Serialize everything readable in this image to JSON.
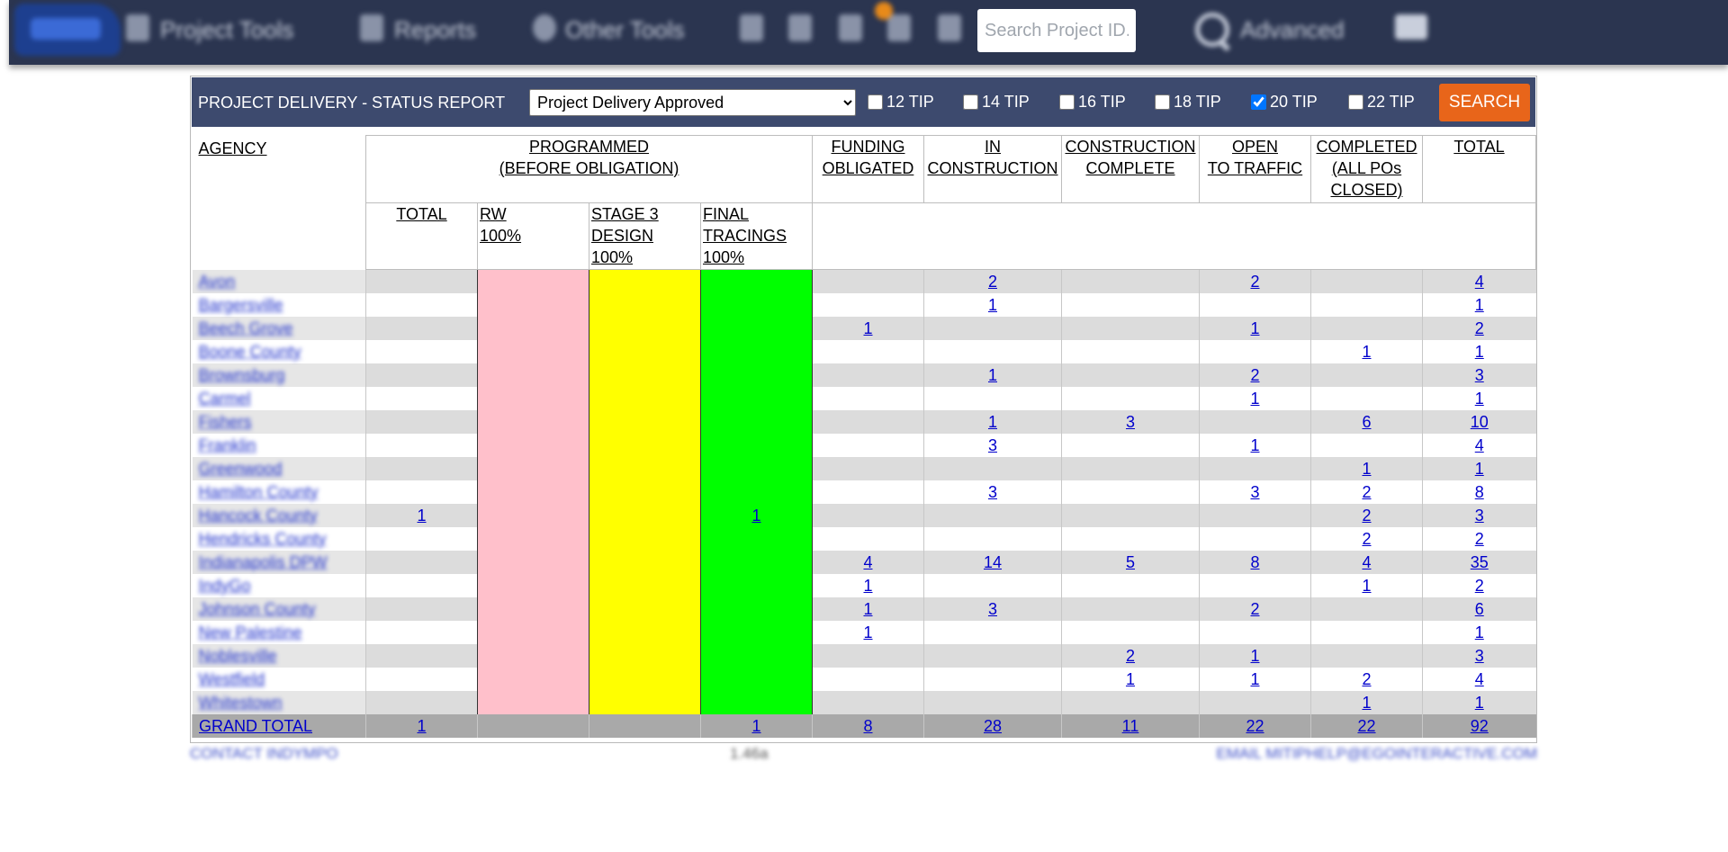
{
  "nav": {
    "items": [
      "Project Tools",
      "Reports",
      "Other Tools"
    ],
    "search_placeholder": "Search Project ID...",
    "advanced_label": "Advanced"
  },
  "filter": {
    "title": "PROJECT DELIVERY - STATUS REPORT",
    "selected_status": "Project Delivery Approved",
    "tips": [
      {
        "label": "12 TIP",
        "checked": false
      },
      {
        "label": "14 TIP",
        "checked": false
      },
      {
        "label": "16 TIP",
        "checked": false
      },
      {
        "label": "18 TIP",
        "checked": false
      },
      {
        "label": "20 TIP",
        "checked": true
      },
      {
        "label": "22 TIP",
        "checked": false
      }
    ],
    "search_label": "SEARCH"
  },
  "table": {
    "agency_header": "AGENCY",
    "programmed_header": [
      "PROGRAMMED",
      "(BEFORE OBLIGATION)"
    ],
    "funding_header": [
      "FUNDING",
      "OBLIGATED"
    ],
    "in_construction_header": [
      "IN",
      "CONSTRUCTION"
    ],
    "construction_complete_header": [
      "CONSTRUCTION",
      "COMPLETE"
    ],
    "open_header": [
      "OPEN",
      "TO TRAFFIC"
    ],
    "completed_header": [
      "COMPLETED",
      "(ALL POs",
      "CLOSED)"
    ],
    "total_header": "TOTAL",
    "sub_total_header": "TOTAL",
    "rw_header": [
      "RW",
      "100%"
    ],
    "stage3_header": [
      "STAGE 3",
      "DESIGN",
      "100%"
    ],
    "final_header": [
      "FINAL",
      "TRACINGS",
      "100%"
    ],
    "rows": [
      {
        "agency": "Avon",
        "prog_total": "",
        "rw": "",
        "stage3": "",
        "final": "",
        "funding": "",
        "in_constr": "2",
        "constr_complete": "",
        "open": "2",
        "completed": "",
        "total": "4"
      },
      {
        "agency": "Bargersville",
        "prog_total": "",
        "rw": "",
        "stage3": "",
        "final": "",
        "funding": "",
        "in_constr": "1",
        "constr_complete": "",
        "open": "",
        "completed": "",
        "total": "1"
      },
      {
        "agency": "Beech Grove",
        "prog_total": "",
        "rw": "",
        "stage3": "",
        "final": "",
        "funding": "1",
        "in_constr": "",
        "constr_complete": "",
        "open": "1",
        "completed": "",
        "total": "2"
      },
      {
        "agency": "Boone County",
        "prog_total": "",
        "rw": "",
        "stage3": "",
        "final": "",
        "funding": "",
        "in_constr": "",
        "constr_complete": "",
        "open": "",
        "completed": "1",
        "total": "1"
      },
      {
        "agency": "Brownsburg",
        "prog_total": "",
        "rw": "",
        "stage3": "",
        "final": "",
        "funding": "",
        "in_constr": "1",
        "constr_complete": "",
        "open": "2",
        "completed": "",
        "total": "3"
      },
      {
        "agency": "Carmel",
        "prog_total": "",
        "rw": "",
        "stage3": "",
        "final": "",
        "funding": "",
        "in_constr": "",
        "constr_complete": "",
        "open": "1",
        "completed": "",
        "total": "1"
      },
      {
        "agency": "Fishers",
        "prog_total": "",
        "rw": "",
        "stage3": "",
        "final": "",
        "funding": "",
        "in_constr": "1",
        "constr_complete": "3",
        "open": "",
        "completed": "6",
        "total": "10"
      },
      {
        "agency": "Franklin",
        "prog_total": "",
        "rw": "",
        "stage3": "",
        "final": "",
        "funding": "",
        "in_constr": "3",
        "constr_complete": "",
        "open": "1",
        "completed": "",
        "total": "4"
      },
      {
        "agency": "Greenwood",
        "prog_total": "",
        "rw": "",
        "stage3": "",
        "final": "",
        "funding": "",
        "in_constr": "",
        "constr_complete": "",
        "open": "",
        "completed": "1",
        "total": "1"
      },
      {
        "agency": "Hamilton County",
        "prog_total": "",
        "rw": "",
        "stage3": "",
        "final": "",
        "funding": "",
        "in_constr": "3",
        "constr_complete": "",
        "open": "3",
        "completed": "2",
        "total": "8"
      },
      {
        "agency": "Hancock County",
        "prog_total": "1",
        "rw": "",
        "stage3": "",
        "final": "1",
        "funding": "",
        "in_constr": "",
        "constr_complete": "",
        "open": "",
        "completed": "2",
        "total": "3"
      },
      {
        "agency": "Hendricks County",
        "prog_total": "",
        "rw": "",
        "stage3": "",
        "final": "",
        "funding": "",
        "in_constr": "",
        "constr_complete": "",
        "open": "",
        "completed": "2",
        "total": "2"
      },
      {
        "agency": "Indianapolis DPW",
        "prog_total": "",
        "rw": "",
        "stage3": "",
        "final": "",
        "funding": "4",
        "in_constr": "14",
        "constr_complete": "5",
        "open": "8",
        "completed": "4",
        "total": "35"
      },
      {
        "agency": "IndyGo",
        "prog_total": "",
        "rw": "",
        "stage3": "",
        "final": "",
        "funding": "1",
        "in_constr": "",
        "constr_complete": "",
        "open": "",
        "completed": "1",
        "total": "2"
      },
      {
        "agency": "Johnson County",
        "prog_total": "",
        "rw": "",
        "stage3": "",
        "final": "",
        "funding": "1",
        "in_constr": "3",
        "constr_complete": "",
        "open": "2",
        "completed": "",
        "total": "6"
      },
      {
        "agency": "New Palestine",
        "prog_total": "",
        "rw": "",
        "stage3": "",
        "final": "",
        "funding": "1",
        "in_constr": "",
        "constr_complete": "",
        "open": "",
        "completed": "",
        "total": "1"
      },
      {
        "agency": "Noblesville",
        "prog_total": "",
        "rw": "",
        "stage3": "",
        "final": "",
        "funding": "",
        "in_constr": "",
        "constr_complete": "2",
        "open": "1",
        "completed": "",
        "total": "3"
      },
      {
        "agency": "Westfield",
        "prog_total": "",
        "rw": "",
        "stage3": "",
        "final": "",
        "funding": "",
        "in_constr": "",
        "constr_complete": "1",
        "open": "1",
        "completed": "2",
        "total": "4"
      },
      {
        "agency": "Whitestown",
        "prog_total": "",
        "rw": "",
        "stage3": "",
        "final": "",
        "funding": "",
        "in_constr": "",
        "constr_complete": "",
        "open": "",
        "completed": "1",
        "total": "1"
      }
    ],
    "grand_total": {
      "agency": "GRAND TOTAL",
      "prog_total": "1",
      "rw": "",
      "stage3": "",
      "final": "1",
      "funding": "8",
      "in_constr": "28",
      "constr_complete": "11",
      "open": "22",
      "completed": "22",
      "total": "92"
    }
  },
  "footer": {
    "contact": "CONTACT INDYMPO",
    "version": "1.46a",
    "email": "EMAIL MITIPHELP@EGOINTERACTIVE.COM"
  }
}
